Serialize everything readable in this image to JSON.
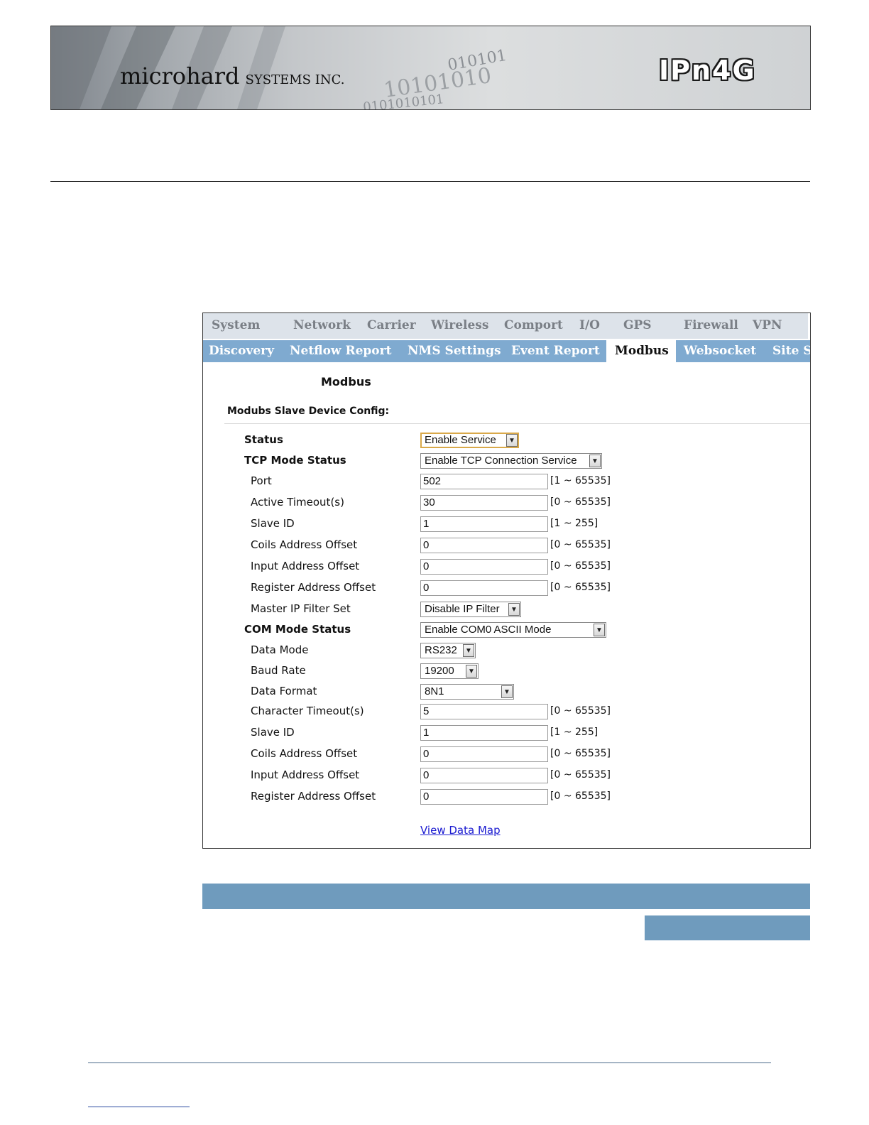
{
  "header": {
    "company_main": "microhard",
    "company_suffix": "SYSTEMS INC.",
    "product": "IPn4G",
    "binary_rows": [
      "010101",
      "10101010",
      "0101010101"
    ]
  },
  "nav": {
    "main": [
      "System",
      "Network",
      "Carrier",
      "Wireless",
      "Comport",
      "I/O",
      "GPS",
      "Firewall",
      "VPN"
    ],
    "sub": [
      "Discovery",
      "Netflow Report",
      "NMS Settings",
      "Event Report",
      "Modbus",
      "Websocket",
      "Site S"
    ],
    "active_sub": "Modbus"
  },
  "page": {
    "title": "Modbus",
    "section": "Modubs Slave Device Config:"
  },
  "fields": {
    "status": {
      "label": "Status",
      "value": "Enable Service"
    },
    "tcp_mode": {
      "label": "TCP Mode Status",
      "value": "Enable TCP Connection Service"
    },
    "port": {
      "label": "Port",
      "value": "502",
      "range": "[1 ~ 65535]"
    },
    "active_timeout": {
      "label": "Active Timeout(s)",
      "value": "30",
      "range": "[0 ~ 65535]"
    },
    "tcp_slave_id": {
      "label": "Slave ID",
      "value": "1",
      "range": "[1 ~ 255]"
    },
    "tcp_coils": {
      "label": "Coils Address Offset",
      "value": "0",
      "range": "[0 ~ 65535]"
    },
    "tcp_input": {
      "label": "Input Address Offset",
      "value": "0",
      "range": "[0 ~ 65535]"
    },
    "tcp_register": {
      "label": "Register Address Offset",
      "value": "0",
      "range": "[0 ~ 65535]"
    },
    "master_ip_filter": {
      "label": "Master IP Filter Set",
      "value": "Disable IP Filter"
    },
    "com_mode": {
      "label": "COM Mode Status",
      "value": "Enable COM0 ASCII Mode"
    },
    "data_mode": {
      "label": "Data Mode",
      "value": "RS232"
    },
    "baud_rate": {
      "label": "Baud Rate",
      "value": "19200"
    },
    "data_format": {
      "label": "Data Format",
      "value": "8N1"
    },
    "char_timeout": {
      "label": "Character Timeout(s)",
      "value": "5",
      "range": "[0 ~ 65535]"
    },
    "com_slave_id": {
      "label": "Slave ID",
      "value": "1",
      "range": "[1 ~ 255]"
    },
    "com_coils": {
      "label": "Coils Address Offset",
      "value": "0",
      "range": "[0 ~ 65535]"
    },
    "com_input": {
      "label": "Input Address Offset",
      "value": "0",
      "range": "[0 ~ 65535]"
    },
    "com_register": {
      "label": "Register Address Offset",
      "value": "0",
      "range": "[0 ~ 65535]"
    }
  },
  "actions": {
    "view_data_map": "View Data Map"
  },
  "icons": {
    "dropdown": "chevron-down-icon"
  },
  "colors": {
    "nav_sub_bg": "#7faad0",
    "nav_main_bg": "#dde3ea",
    "section_bar": "#6f9bbd",
    "focus_border": "#d9a94a"
  }
}
